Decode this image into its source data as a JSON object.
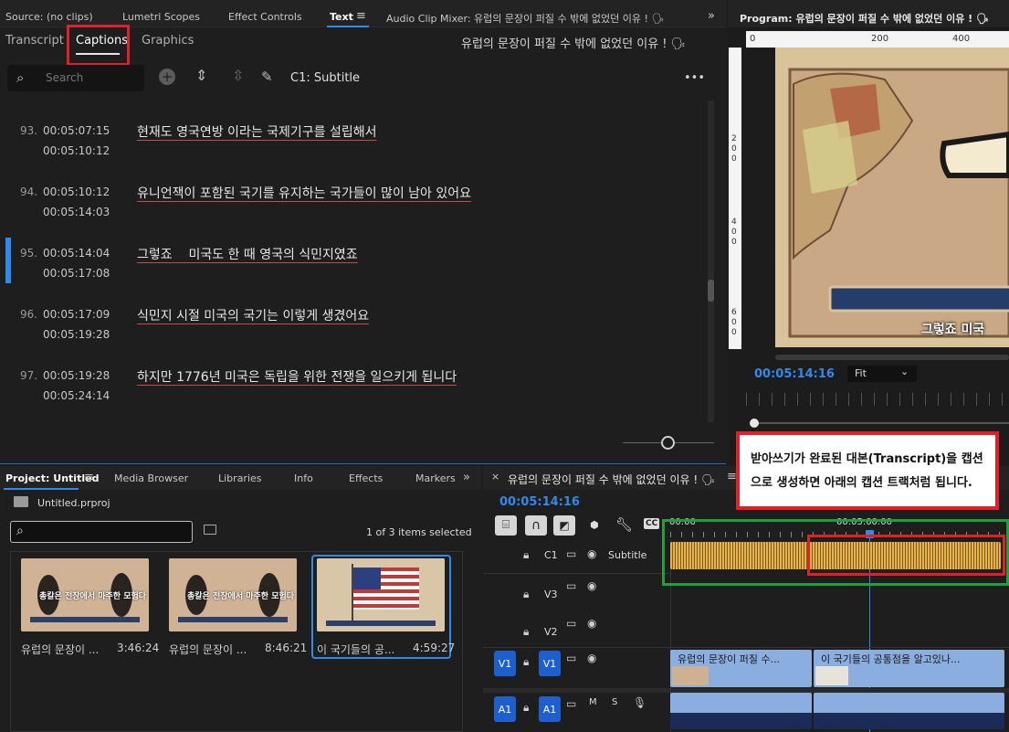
{
  "source_panel": {
    "tabs": [
      "Source: (no clips)",
      "Lumetri Scopes",
      "Effect Controls",
      "Text",
      "Audio Clip Mixer: 유럽의 문장이 퍼질 수 밖에 없었던 이유 ! 🗣"
    ],
    "subtabs": [
      "Transcript",
      "Captions",
      "Graphics"
    ],
    "active_subtab": "Captions",
    "sequence_title": "유럽의 문장이 퍼질 수 밖에 없었던 이유 ! 🗣",
    "search_placeholder": "Search",
    "track_label": "C1: Subtitle",
    "more": "•••"
  },
  "captions": [
    {
      "num": "93.",
      "in": "00:05:07:15",
      "out": "00:05:10:12",
      "text": "현재도 영국연방 이라는 국제기구를 설립해서",
      "active": false
    },
    {
      "num": "94.",
      "in": "00:05:10:12",
      "out": "00:05:14:03",
      "text": "유니언잭이 포함된 국기를 유지하는 국가들이 많이 남아 있어요",
      "active": false
    },
    {
      "num": "95.",
      "in": "00:05:14:04",
      "out": "00:05:17:08",
      "text": "그렇죠    미국도 한 때 영국의 식민지였죠",
      "active": true
    },
    {
      "num": "96.",
      "in": "00:05:17:09",
      "out": "00:05:19:28",
      "text": "식민지 시절 미국의 국기는 이렇게 생겼어요",
      "active": false
    },
    {
      "num": "97.",
      "in": "00:05:19:28",
      "out": "00:05:24:14",
      "text": "하지만 1776년 미국은 독립을 위한 전쟁을 일으키게 됩니다",
      "active": false
    }
  ],
  "program": {
    "title": "Program: 유럽의 문장이 퍼질 수 밖에 없었던 이유 ! 🗣",
    "ruler_labels": [
      "0",
      "200",
      "400"
    ],
    "v_labels": [
      "2\n0\n0",
      "4\n0\n0",
      "6\n0\n0"
    ],
    "timecode": "00:05:14:16",
    "fit": "Fit",
    "video_subtitle": "그렇죠 미국"
  },
  "annotation": {
    "text": "받아쓰기가 완료된 대본(Transcript)을 캡션으로 생성하면 아래의 캡션 트랙처럼 됩니다."
  },
  "project": {
    "tabs": [
      "Project: Untitled",
      "Media Browser",
      "Libraries",
      "Info",
      "Effects",
      "Markers"
    ],
    "file": "Untitled.prproj",
    "items_count": "1 of 3 items selected",
    "items": [
      {
        "label": "유럽의 문장이 ...",
        "duration": "3:46:24",
        "thumb_text": "총칼은 전장에서 마주한 모험다"
      },
      {
        "label": "유럽의 문장이 ...",
        "duration": "8:46:21",
        "thumb_text": "총칼은 전장에서 마주한 모험다"
      },
      {
        "label": "이 국기들의 공...",
        "duration": "4:59:27",
        "thumb_text": ""
      }
    ]
  },
  "timeline": {
    "title": "유럽의 문장이 퍼질 수 밖에 없었던 이유 ! 🗣",
    "timecode": "00:05:14:16",
    "ruler": [
      "00:00",
      "00:05:00:00"
    ],
    "tracks": [
      {
        "name": "C1",
        "label": "Subtitle"
      },
      {
        "name": "V3",
        "label": ""
      },
      {
        "name": "V2",
        "label": ""
      },
      {
        "name": "V1",
        "label": ""
      },
      {
        "name": "A1",
        "label": ""
      }
    ],
    "v1_clips": [
      "유럽의 문장이 퍼질 수...",
      "이 국기들의 공통점을 알고있나..."
    ],
    "a1_mute": "M",
    "a1_solo": "S"
  },
  "colors": {
    "accent_blue": "#2d8ceb",
    "annotation_red": "#e0212b",
    "annotation_green": "#1ea13b",
    "caption_clip": "#e8b24a",
    "video_clip": "#8aaee0"
  }
}
